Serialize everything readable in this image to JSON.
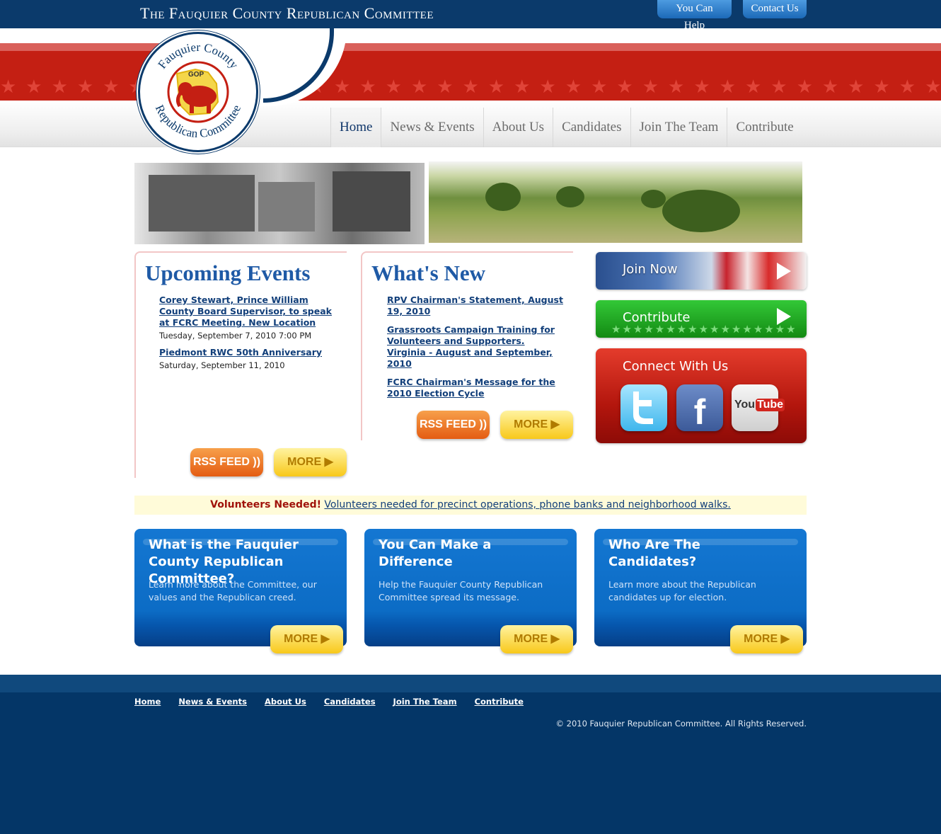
{
  "header": {
    "title": "The Fauquier County Republican Committee",
    "utility": {
      "help": "You Can Help",
      "contact": "Contact Us"
    },
    "seal": {
      "top_text": "Fauquier County",
      "bottom_text": "Republican Committee",
      "badge": "GOP"
    }
  },
  "nav": {
    "items": [
      "Home",
      "News & Events",
      "About Us",
      "Candidates",
      "Join The Team",
      "Contribute"
    ],
    "active": "Home"
  },
  "events": {
    "title": "Upcoming Events",
    "items": [
      {
        "link": "Corey Stewart, Prince William County Board Supervisor, to speak at FCRC Meeting. New Location",
        "date": "Tuesday, September 7, 2010 7:00 PM"
      },
      {
        "link": "Piedmont RWC 50th Anniversary",
        "date": "Saturday, September 11, 2010"
      }
    ],
    "rss_label": "RSS FEED",
    "more_label": "MORE"
  },
  "news": {
    "title": "What's New",
    "items": [
      "RPV Chairman's Statement, August 19, 2010",
      "Grassroots Campaign Training for Volunteers and Supporters. Virginia - August and September, 2010",
      "FCRC Chairman's Message for the 2010 Election Cycle"
    ],
    "rss_label": "RSS FEED",
    "more_label": "MORE"
  },
  "sidebar": {
    "join_now": "Join Now",
    "contribute": "Contribute",
    "connect": "Connect With Us",
    "social": {
      "facebook_glyph": "f",
      "youtube_you": "You",
      "youtube_tube": "Tube"
    }
  },
  "volunteer": {
    "bold": "Volunteers Needed!",
    "link": "Volunteers needed for precinct operations, phone banks and neighborhood walks."
  },
  "promos": [
    {
      "title": "What is the Fauquier County Republican Committee?",
      "text": "Learn more about the Committee, our values and the Republican creed.",
      "more": "MORE"
    },
    {
      "title": "You Can Make a Difference",
      "text": "Help the Fauquier County Republican Committee spread its message.",
      "more": "MORE"
    },
    {
      "title": "Who Are The Candidates?",
      "text": "Learn more about the Republican candidates up for election.",
      "more": "MORE"
    }
  ],
  "footer": {
    "links": [
      "Home",
      "News & Events",
      "About Us",
      "Candidates",
      "Join The Team",
      "Contribute"
    ],
    "copyright": "© 2010 Fauquier Republican Committee. All Rights Reserved."
  },
  "colors": {
    "navy": "#0b3a6b",
    "banner_red": "#c41f13",
    "title_blue": "#1f5aa6",
    "promo_blue": "#1477d2",
    "footer_navy": "#043667"
  },
  "icons": [
    "rss-icon",
    "play-arrow-icon",
    "twitter-icon",
    "facebook-icon",
    "youtube-icon",
    "elephant-icon",
    "star-icon"
  ]
}
